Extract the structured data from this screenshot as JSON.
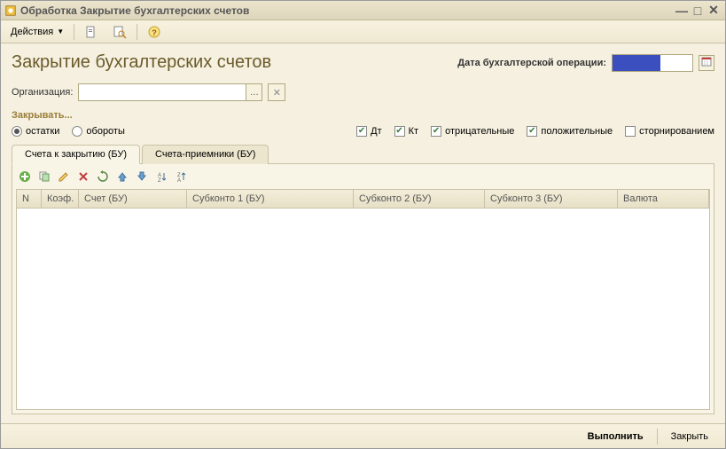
{
  "window": {
    "title": "Обработка  Закрытие бухгалтерских счетов"
  },
  "toolbar": {
    "actions_label": "Действия"
  },
  "page": {
    "title": "Закрытие бухгалтерских счетов"
  },
  "date": {
    "label": "Дата бухгалтерской операции:",
    "value": ""
  },
  "org": {
    "label": "Организация:"
  },
  "close_section": {
    "label": "Закрывать..."
  },
  "radios": {
    "balances": "остатки",
    "turnovers": "обороты"
  },
  "checks": {
    "dt": "Дт",
    "kt": "Кт",
    "neg": "отрицательные",
    "pos": "положительные",
    "storno": "сторнированием"
  },
  "tabs": {
    "tab1": "Счета к закрытию (БУ)",
    "tab2": "Счета-приемники (БУ)"
  },
  "columns": {
    "n": "N",
    "koef": "Коэф.",
    "acct": "Счет (БУ)",
    "sub1": "Субконто 1 (БУ)",
    "sub2": "Субконто 2 (БУ)",
    "sub3": "Субконто 3 (БУ)",
    "currency": "Валюта"
  },
  "footer": {
    "execute": "Выполнить",
    "close": "Закрыть"
  }
}
